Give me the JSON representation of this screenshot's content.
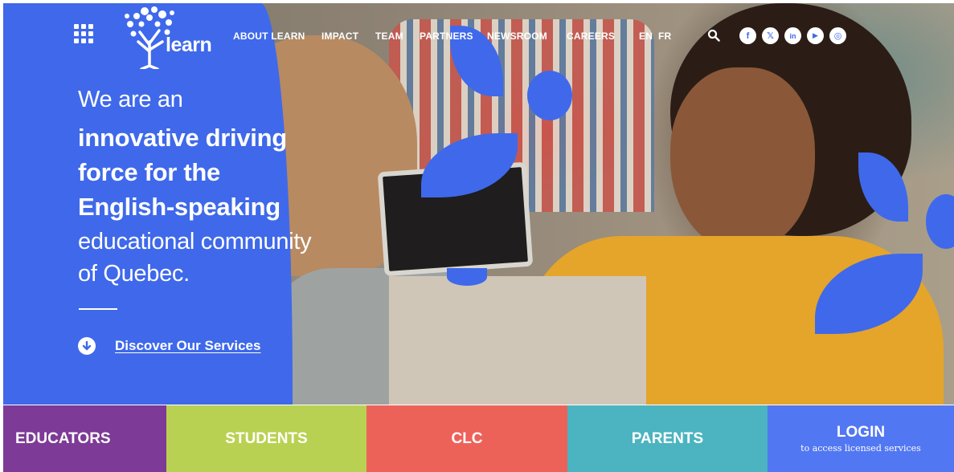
{
  "site": {
    "logo_text": "learn",
    "colors": {
      "brand_blue": "#3f69ea",
      "educators": "#7d3a96",
      "students": "#b9d152",
      "clc": "#ec6259",
      "parents": "#4bb4c0",
      "login": "#5277f2"
    }
  },
  "nav": {
    "menu_icon": "apps-grid-icon",
    "items": [
      {
        "label": "ABOUT LEARN"
      },
      {
        "label": "IMPACT"
      },
      {
        "label": "TEAM"
      },
      {
        "label": "PARTNERS"
      },
      {
        "label": "NEWSROOM"
      },
      {
        "label": "CAREERS"
      }
    ],
    "languages": [
      "EN",
      "FR"
    ],
    "search_icon": "search-icon",
    "social": [
      {
        "icon": "facebook-icon",
        "glyph": "f"
      },
      {
        "icon": "x-icon",
        "glyph": "𝕏"
      },
      {
        "icon": "linkedin-icon",
        "glyph": "in"
      },
      {
        "icon": "youtube-icon",
        "glyph": "▶"
      },
      {
        "icon": "instagram-icon",
        "glyph": "◎"
      }
    ]
  },
  "hero": {
    "line1": "We are an",
    "bold1": "innovative driving",
    "bold2": "force for the",
    "bold3": "English-speaking",
    "line2": "educational community",
    "line3": "of Quebec.",
    "cta": "Discover Our Services"
  },
  "tiles": [
    {
      "label": "EDUCATORS"
    },
    {
      "label": "STUDENTS"
    },
    {
      "label": "CLC"
    },
    {
      "label": "PARENTS"
    },
    {
      "label": "LOGIN",
      "sub": "to access licensed services"
    }
  ]
}
